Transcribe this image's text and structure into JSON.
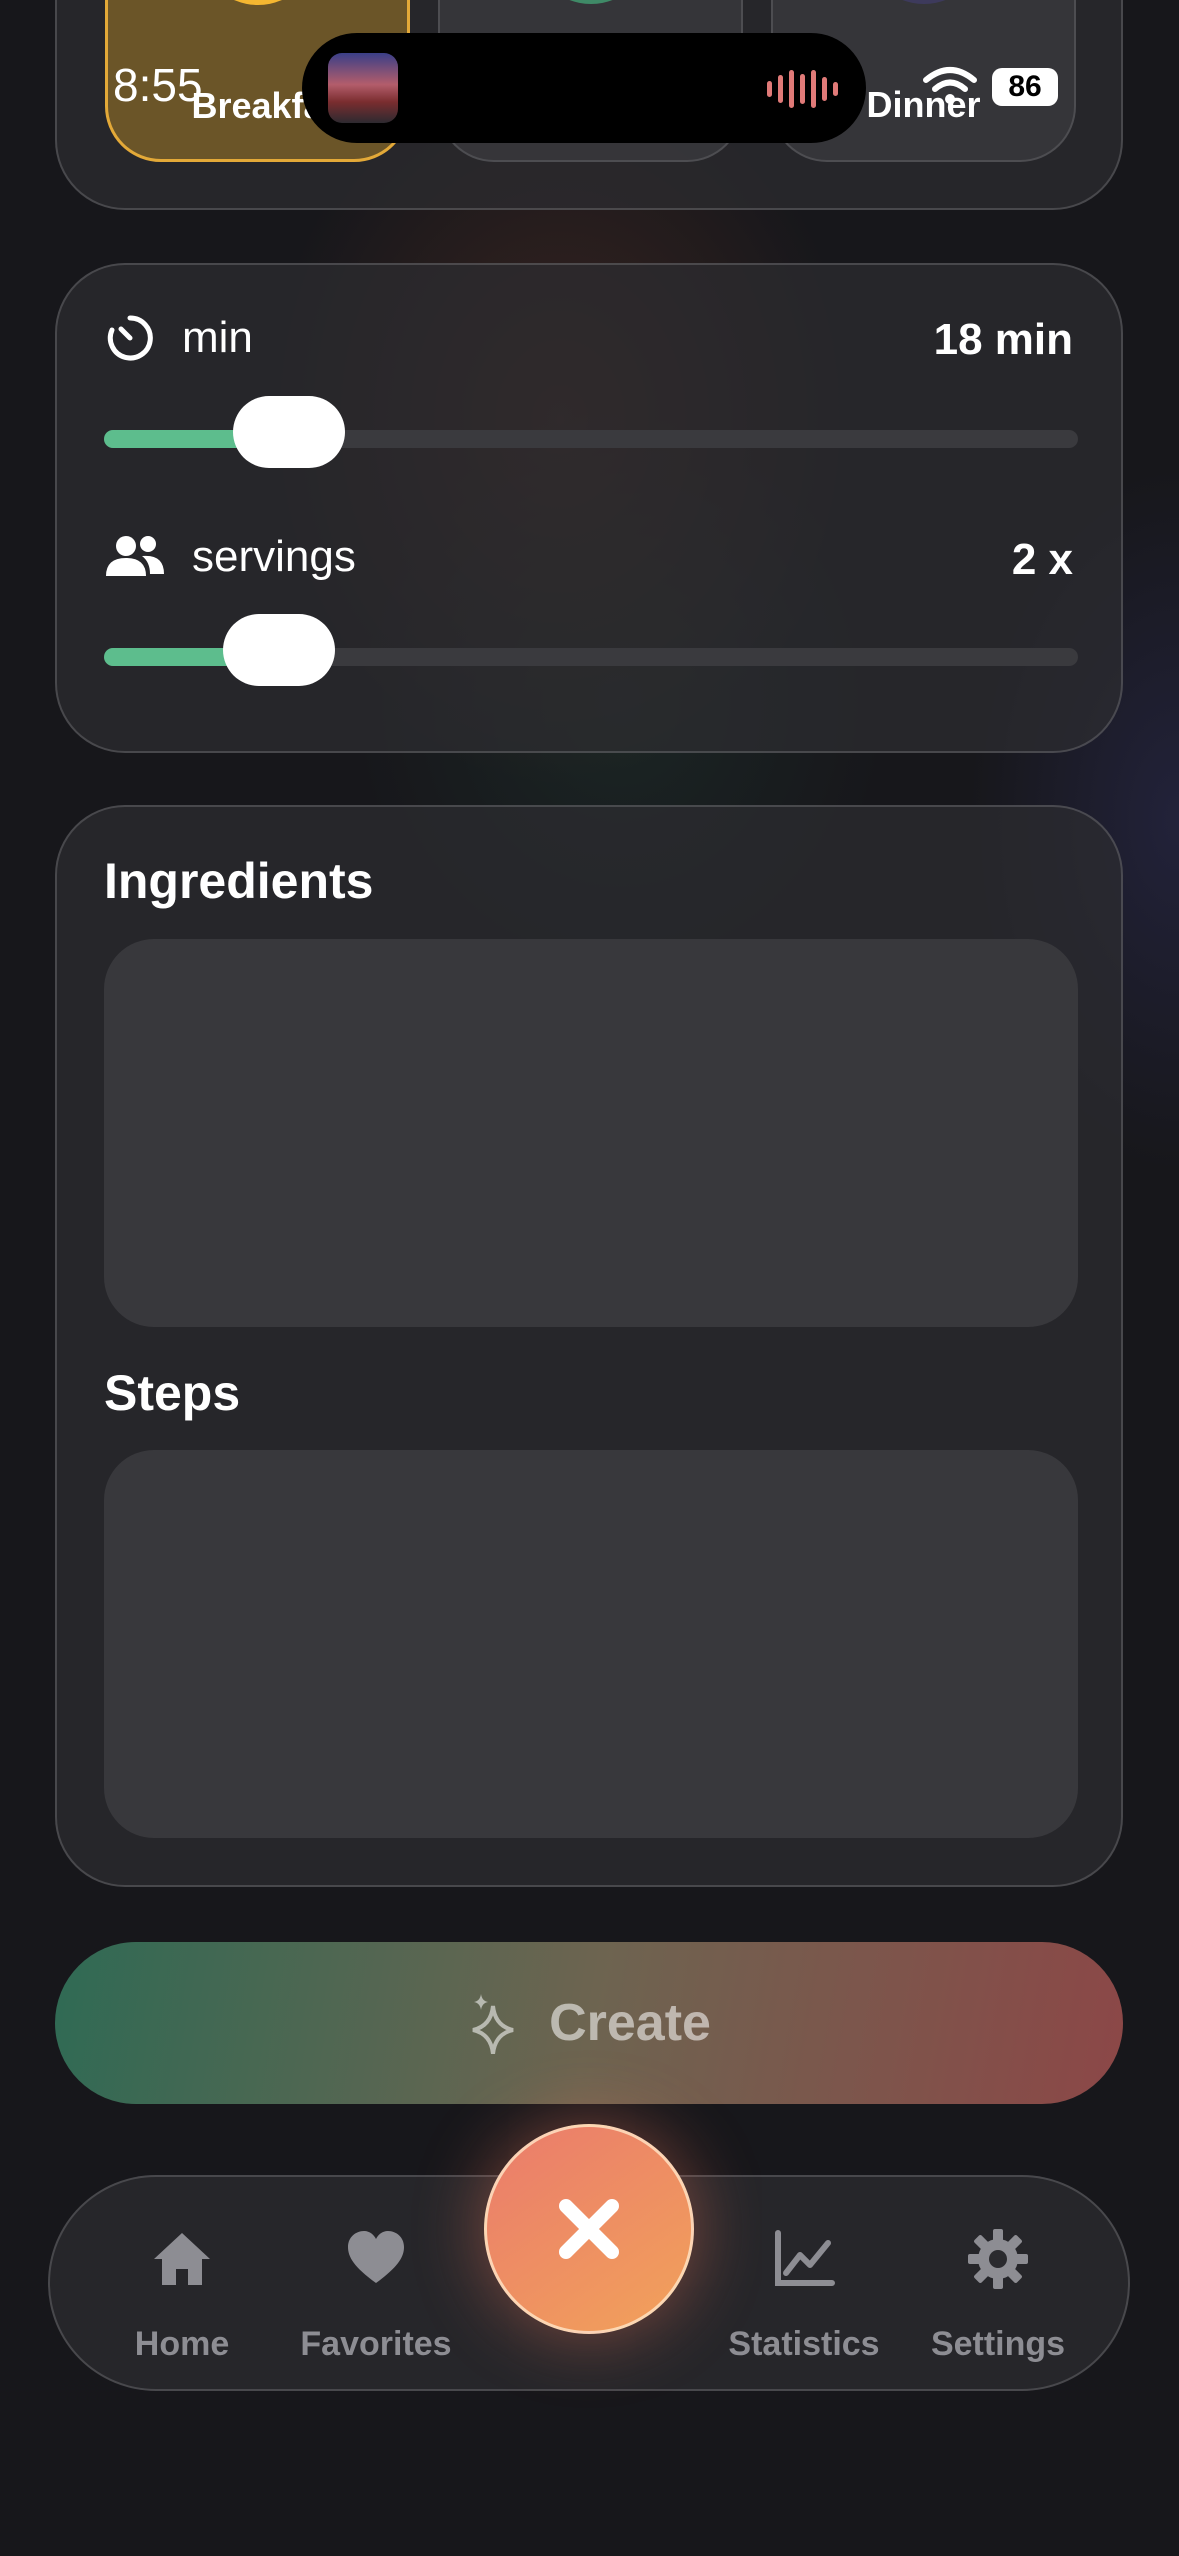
{
  "status_bar": {
    "time": "8:55",
    "battery": "86"
  },
  "meal_types": {
    "items": [
      {
        "label": "Breakfa",
        "icon": "breakfast-icon",
        "color": "#f5b731",
        "active": true
      },
      {
        "label": "",
        "icon": "lunch-icon",
        "color": "#3f8a67",
        "active": false
      },
      {
        "label": "Dinner",
        "icon": "moon-icon",
        "color": "#6b5fd6",
        "active": false
      }
    ]
  },
  "time_slider": {
    "label": "min",
    "value_text": "18 min",
    "fraction": 0.19,
    "icon": "timer-icon"
  },
  "servings_slider": {
    "label": "servings",
    "value_text": "2 x",
    "fraction": 0.18,
    "icon": "people-icon"
  },
  "recipe": {
    "ingredients_title": "Ingredients",
    "steps_title": "Steps"
  },
  "create_button": {
    "label": "Create",
    "icon": "sparkles-icon"
  },
  "tab_bar": {
    "tabs": [
      {
        "label": "Home",
        "icon": "home-icon"
      },
      {
        "label": "Favorites",
        "icon": "heart-icon"
      },
      {
        "label": "Statistics",
        "icon": "chart-icon"
      },
      {
        "label": "Settings",
        "icon": "gear-icon"
      }
    ],
    "center_action": "close-icon"
  },
  "colors": {
    "accent_green": "#5dbd8d",
    "accent_orange": "#f2a25a",
    "background": "#17171b"
  }
}
